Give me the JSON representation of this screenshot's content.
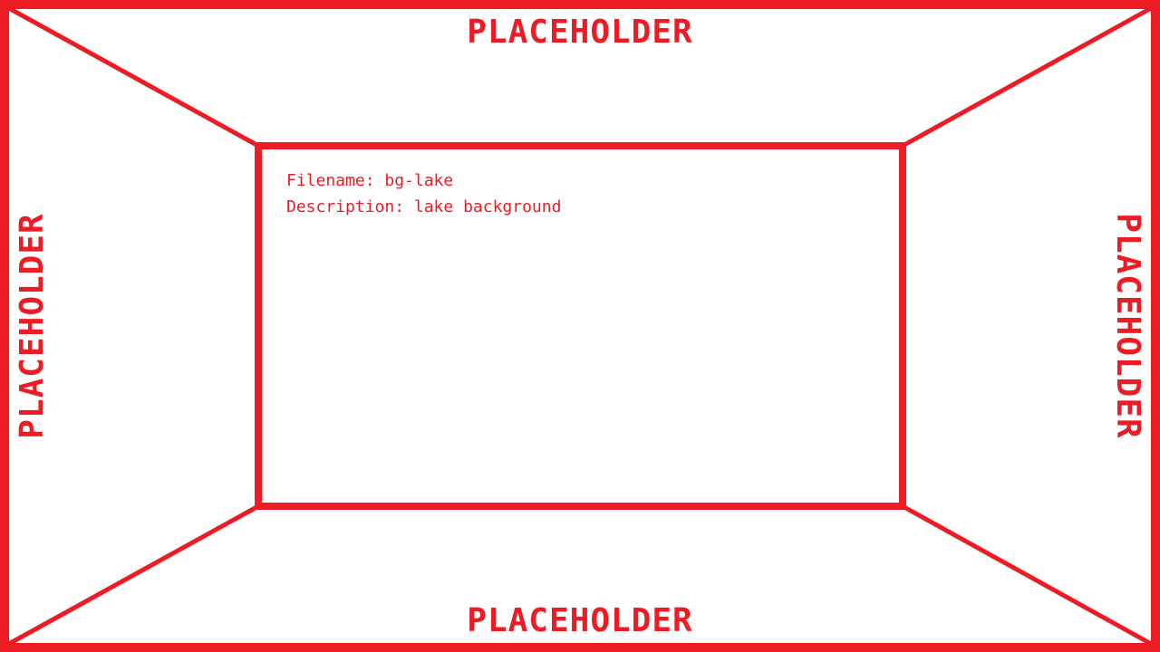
{
  "placeholders": {
    "top": "PLACEHOLDER",
    "bottom": "PLACEHOLDER",
    "left": "PLACEHOLDER",
    "right": "PLACEHOLDER"
  },
  "file": {
    "filename_line": "Filename: bg-lake",
    "description_line": "Description: lake background"
  },
  "colors": {
    "accent": "#ed1c24",
    "background": "#ffffff"
  }
}
